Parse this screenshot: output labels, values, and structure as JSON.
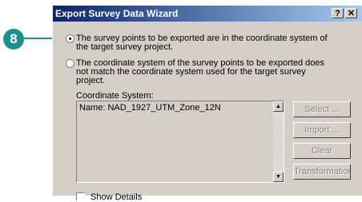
{
  "callout": {
    "number": "8"
  },
  "dialog": {
    "title": "Export Survey Data Wizard",
    "help_label": "?",
    "close_label": "✕",
    "options": [
      {
        "label": "The survey points to be exported are in the coordinate system of the target survey project.",
        "selected": true
      },
      {
        "label": "The coordinate system of the survey points to be exported does not match the coordinate system used for the target survey project.",
        "selected": false
      }
    ],
    "coordinate_system": {
      "label": "Coordinate System:",
      "value": "Name: NAD_1927_UTM_Zone_12N"
    },
    "buttons": {
      "select": "Select ...",
      "import": "Import ...",
      "clear": "Clear",
      "transformation": "Transformation"
    },
    "show_details": {
      "label": "Show Details",
      "checked": false
    }
  }
}
